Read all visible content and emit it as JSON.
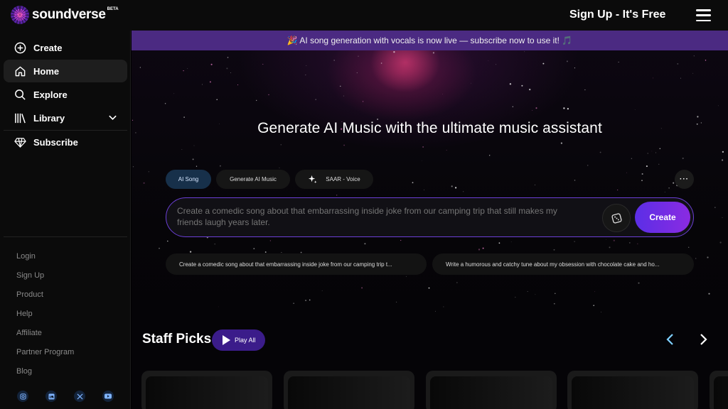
{
  "app": {
    "logo_text": "soundverse",
    "logo_badge": "BETA",
    "signup_cta": "Sign Up - It's Free"
  },
  "sidebar": {
    "nav": [
      {
        "label": "Create",
        "icon": "plus-circle-icon"
      },
      {
        "label": "Home",
        "icon": "home-icon",
        "active": true
      },
      {
        "label": "Explore",
        "icon": "search-icon"
      },
      {
        "label": "Library",
        "icon": "library-icon",
        "expandable": true
      },
      {
        "label": "Subscribe",
        "icon": "diamond-icon"
      }
    ],
    "links": [
      "Login",
      "Sign Up",
      "Product",
      "Help",
      "Affiliate",
      "Partner Program",
      "Blog"
    ],
    "socials": [
      "instagram-icon",
      "linkedin-icon",
      "x-icon",
      "youtube-icon"
    ]
  },
  "banner": {
    "text": "🎉 AI song generation with vocals is now live — subscribe now to use it! 🎵"
  },
  "hero": {
    "title": "Generate AI Music with the ultimate music assistant"
  },
  "mode_tabs": [
    {
      "label": "AI Song",
      "active": true
    },
    {
      "label": "Generate AI Music"
    },
    {
      "label": "SAAR - Voice",
      "icon": "sparkle-icon"
    }
  ],
  "prompt": {
    "placeholder": "Create a comedic song about that embarrassing inside joke from our camping trip that still makes my friends laugh years later.",
    "create_label": "Create"
  },
  "suggestions": [
    "Create a comedic song about that embarrassing inside joke from our camping trip t...",
    "Write a humorous and catchy tune about my obsession with chocolate cake and ho..."
  ],
  "staff_picks": {
    "title": "Staff Picks",
    "play_all_label": "Play All",
    "card_count_visible": 5
  },
  "colors": {
    "accent_purple": "#6b3fd6",
    "banner_bg": "#4b2a82",
    "create_gradient_start": "#5b2ee6",
    "create_gradient_end": "#8a2be2",
    "nav_arrow": "#7fd0ff"
  }
}
